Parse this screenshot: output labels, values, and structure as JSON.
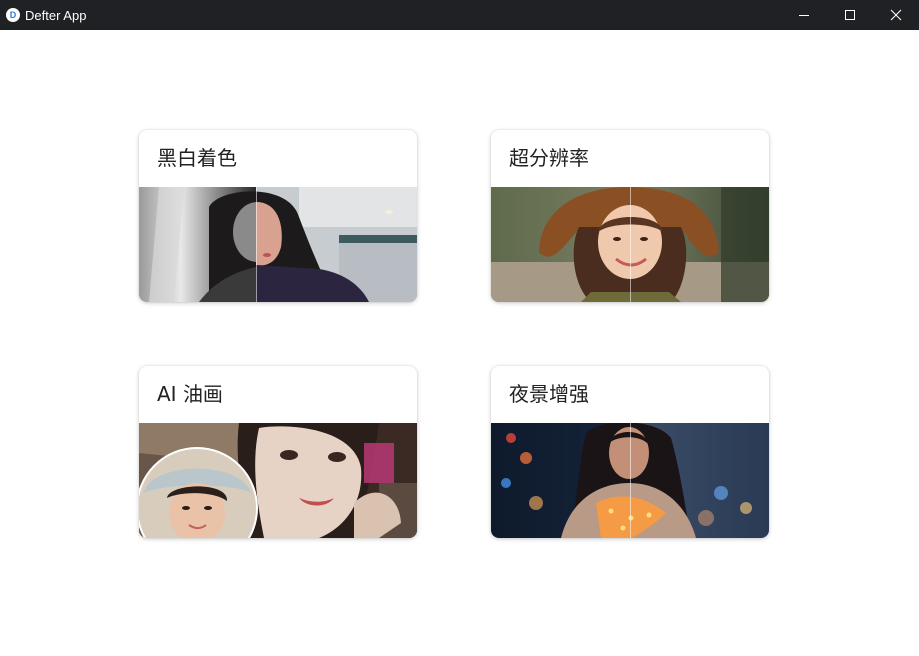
{
  "window": {
    "title": "Defter App",
    "logo_letter": "D",
    "controls": [
      "minimize-icon",
      "maximize-icon",
      "close-icon"
    ]
  },
  "cards": [
    {
      "title": "黑白着色",
      "image": "colorize-portrait-image"
    },
    {
      "title": "超分辨率",
      "image": "super-resolution-portrait-image"
    },
    {
      "title": "AI 油画",
      "image": "oil-painting-portrait-image"
    },
    {
      "title": "夜景增强",
      "image": "night-enhance-portrait-image"
    }
  ]
}
